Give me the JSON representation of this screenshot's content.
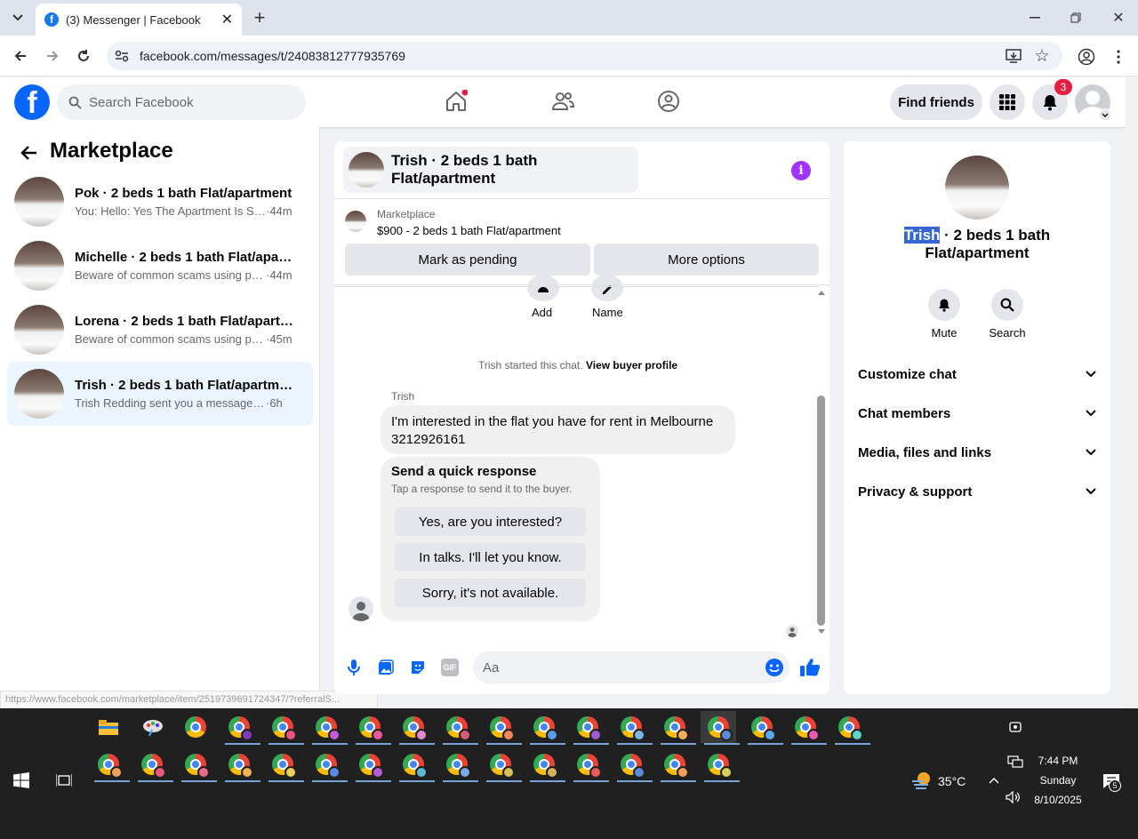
{
  "browser": {
    "tab_title": "(3) Messenger | Facebook",
    "url": "facebook.com/messages/t/24083812777935769",
    "status_url": "https://www.facebook.com/marketplace/item/2519739691724347/?referralS..."
  },
  "fb_header": {
    "search_placeholder": "Search Facebook",
    "find_friends": "Find friends",
    "notification_count": "3"
  },
  "left": {
    "title": "Marketplace",
    "conversations": [
      {
        "name": "Pok · 2 beds 1 bath Flat/apartment",
        "preview": "You: Hello: Yes The Apartment Is Still...",
        "time": "·44m"
      },
      {
        "name": "Michelle · 2 beds 1 bath Flat/apart...",
        "preview": "Beware of common scams using pa...",
        "time": "·44m"
      },
      {
        "name": "Lorena · 2 beds 1 bath Flat/apartm...",
        "preview": "Beware of common scams using pa...",
        "time": "·45m"
      },
      {
        "name": "Trish · 2 beds 1 bath Flat/apartment",
        "preview": "Trish Redding sent you a message ab...",
        "time": "·6h"
      }
    ]
  },
  "chat": {
    "header_title": "Trish · 2 beds 1 bath Flat/apartment",
    "listing_label": "Marketplace",
    "listing_title": "$900 - 2 beds 1 bath Flat/apartment",
    "mark_pending": "Mark as pending",
    "more_options": "More options",
    "add_label": "Add",
    "name_label": "Name",
    "started_text": "Trish started this chat.",
    "view_profile": "View buyer profile",
    "sender": "Trish",
    "message_line1": "I'm interested in the flat you have for rent in Melbourne",
    "message_line2": "3212926161",
    "quick_title": "Send a quick response",
    "quick_sub": "Tap a response to send it to the buyer.",
    "quick_replies": [
      "Yes, are you interested?",
      "In talks. I'll let you know.",
      "Sorry, it's not available."
    ],
    "composer_placeholder": "Aa"
  },
  "right": {
    "name_highlight": "Trish",
    "title_rest": " · 2 beds 1 bath",
    "title_line2": "Flat/apartment",
    "mute": "Mute",
    "search": "Search",
    "sections": [
      "Customize chat",
      "Chat members",
      "Media, files and links",
      "Privacy & support"
    ]
  },
  "taskbar": {
    "weather": "35°C",
    "time": "7:44 PM",
    "day": "Sunday",
    "date": "8/10/2025",
    "notif_count": "5"
  },
  "colors": {
    "fb_blue": "#0866ff",
    "messenger_purple": "#a033ff",
    "badge_red": "#e41e3f",
    "active_row": "#ebf5ff"
  }
}
